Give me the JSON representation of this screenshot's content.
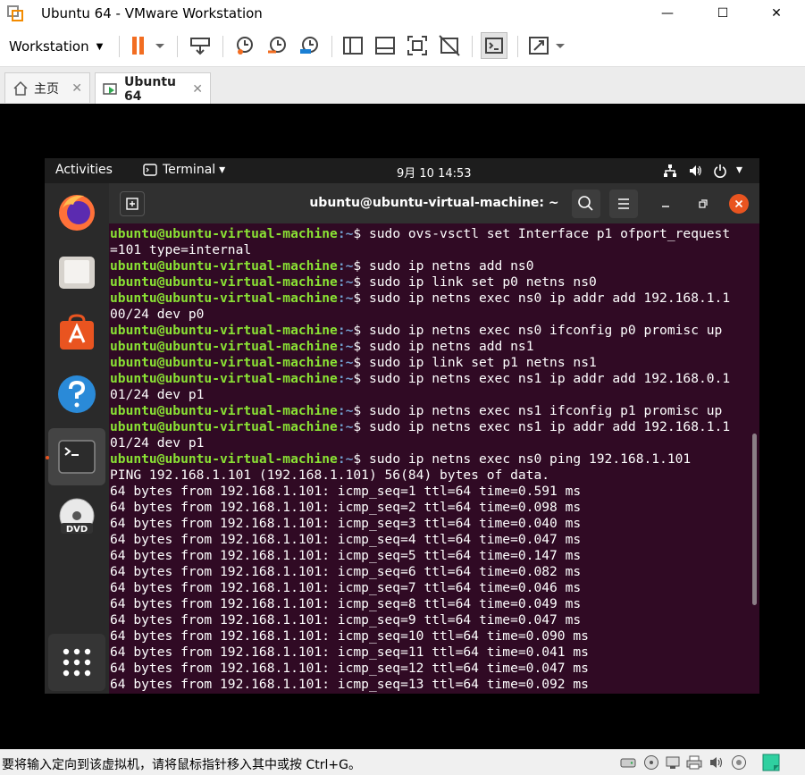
{
  "window": {
    "title": "Ubuntu 64 - VMware Workstation",
    "controls": {
      "minimize": "—",
      "maximize": "☐",
      "close": "✕"
    }
  },
  "toolbar": {
    "menu_label": "Workstation",
    "caret": "▼",
    "icons": [
      "pause-icon",
      "send-keys-icon",
      "snapshot-icon",
      "revert-snapshot-icon",
      "snapshot-manager-icon",
      "library-view-icon",
      "thumbnail-view-icon",
      "full-screen-icon",
      "unity-icon",
      "console-view-icon",
      "stretch-icon"
    ]
  },
  "tabs": [
    {
      "label": "主页",
      "close": "✕",
      "icon": "home-icon"
    },
    {
      "label": "Ubuntu 64",
      "close": "✕",
      "icon": "vm-icon"
    }
  ],
  "ubuntu": {
    "activities": "Activities",
    "app_menu": "Terminal",
    "app_menu_caret": "▾",
    "clock": "9月 10  14:53",
    "tray": {
      "network": "network-icon",
      "volume": "volume-icon",
      "power": "power-icon",
      "menu_caret": "▾"
    },
    "dock": [
      "firefox-icon",
      "files-icon",
      "software-icon",
      "help-icon",
      "terminal-icon",
      "dvd-icon",
      "app-grid-icon"
    ]
  },
  "terminal": {
    "title": "ubuntu@ubuntu-virtual-machine: ~",
    "prompt_user": "ubuntu@ubuntu-virtual-machine",
    "prompt_path": ":~",
    "prompt_symbol": "$ ",
    "lines": [
      {
        "type": "cmd",
        "text": "sudo ovs-vsctl set Interface p1 ofport_request"
      },
      {
        "type": "out",
        "text": "=101 type=internal"
      },
      {
        "type": "cmd",
        "text": "sudo ip netns add ns0"
      },
      {
        "type": "cmd",
        "text": "sudo ip link set p0 netns ns0"
      },
      {
        "type": "cmd",
        "text": "sudo ip netns exec ns0 ip addr add 192.168.1.1"
      },
      {
        "type": "out",
        "text": "00/24 dev p0"
      },
      {
        "type": "cmd",
        "text": "sudo ip netns exec ns0 ifconfig p0 promisc up"
      },
      {
        "type": "cmd",
        "text": "sudo ip netns add ns1"
      },
      {
        "type": "cmd",
        "text": "sudo ip link set p1 netns ns1"
      },
      {
        "type": "cmd",
        "text": "sudo ip netns exec ns1 ip addr add 192.168.0.1"
      },
      {
        "type": "out",
        "text": "01/24 dev p1"
      },
      {
        "type": "cmd",
        "text": "sudo ip netns exec ns1 ifconfig p1 promisc up"
      },
      {
        "type": "cmd",
        "text": "sudo ip netns exec ns1 ip addr add 192.168.1.1"
      },
      {
        "type": "out",
        "text": "01/24 dev p1"
      },
      {
        "type": "cmd",
        "text": "sudo ip netns exec ns0 ping 192.168.1.101"
      },
      {
        "type": "out",
        "text": "PING 192.168.1.101 (192.168.1.101) 56(84) bytes of data."
      },
      {
        "type": "out",
        "text": "64 bytes from 192.168.1.101: icmp_seq=1 ttl=64 time=0.591 ms"
      },
      {
        "type": "out",
        "text": "64 bytes from 192.168.1.101: icmp_seq=2 ttl=64 time=0.098 ms"
      },
      {
        "type": "out",
        "text": "64 bytes from 192.168.1.101: icmp_seq=3 ttl=64 time=0.040 ms"
      },
      {
        "type": "out",
        "text": "64 bytes from 192.168.1.101: icmp_seq=4 ttl=64 time=0.047 ms"
      },
      {
        "type": "out",
        "text": "64 bytes from 192.168.1.101: icmp_seq=5 ttl=64 time=0.147 ms"
      },
      {
        "type": "out",
        "text": "64 bytes from 192.168.1.101: icmp_seq=6 ttl=64 time=0.082 ms"
      },
      {
        "type": "out",
        "text": "64 bytes from 192.168.1.101: icmp_seq=7 ttl=64 time=0.046 ms"
      },
      {
        "type": "out",
        "text": "64 bytes from 192.168.1.101: icmp_seq=8 ttl=64 time=0.049 ms"
      },
      {
        "type": "out",
        "text": "64 bytes from 192.168.1.101: icmp_seq=9 ttl=64 time=0.047 ms"
      },
      {
        "type": "out",
        "text": "64 bytes from 192.168.1.101: icmp_seq=10 ttl=64 time=0.090 ms"
      },
      {
        "type": "out",
        "text": "64 bytes from 192.168.1.101: icmp_seq=11 ttl=64 time=0.041 ms"
      },
      {
        "type": "out",
        "text": "64 bytes from 192.168.1.101: icmp_seq=12 ttl=64 time=0.047 ms"
      },
      {
        "type": "out",
        "text": "64 bytes from 192.168.1.101: icmp_seq=13 ttl=64 time=0.092 ms"
      }
    ]
  },
  "statusbar": {
    "message": "要将输入定向到该虚拟机，请将鼠标指针移入其中或按 Ctrl+G。",
    "icons": [
      "hard-disk-icon",
      "cd-icon",
      "network-adapter-icon",
      "printer-icon",
      "sound-icon",
      "display-icon",
      "message-icon"
    ]
  },
  "colors": {
    "terminal_bg": "#300a24",
    "prompt_green": "#8ae234",
    "path_blue": "#729fcf",
    "pause_orange": "#f26d21",
    "close_red": "#e95420"
  }
}
